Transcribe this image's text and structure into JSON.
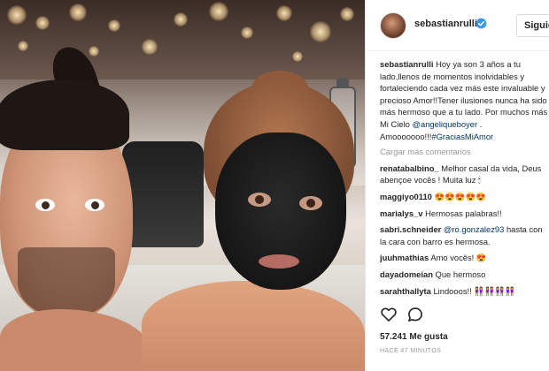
{
  "header": {
    "username": "sebastianrulli",
    "follow_label": "Siguien"
  },
  "post": {
    "caption_user": "sebastianrulli",
    "caption_text_1": "Hoy ya son 3 años a tu lado,llenos de momentos inolvidables y fortaleciendo cada vez más este invaluable y precioso Amor!!Tener ilusiones nunca ha sido más hermoso que a tu lado. Por muchos más Mi Cielo ",
    "caption_mention": "@angeliqueboyer",
    "caption_text_2": " . Amooooooo!!!",
    "caption_hashtag": "#GraciasMiAmor",
    "load_more": "Cargar más comentarios",
    "likes": "57.241 Me gusta",
    "time": "HACE 47 MINUTOS"
  },
  "comments": [
    {
      "user": "renatabalbino_",
      "text": "Melhor casal da vida, Deus abençoe vocês ! Muita luz 🕯"
    },
    {
      "user": "maggiyo0110",
      "text": "😍😍😍😍😍"
    },
    {
      "user": "marialys_v",
      "text": "Hermosas palabras!!"
    },
    {
      "user": "sabri.schneider",
      "mention": "@ro.gonzalez93",
      "text": " hasta con la cara con barro es hermosa."
    },
    {
      "user": "juuhmathias",
      "text": "Amo vocês! 😍"
    },
    {
      "user": "dayadomeian",
      "text": "Que hermoso"
    },
    {
      "user": "sarahthallyta",
      "text": "Lindooos!! 👭👭👭👭"
    }
  ],
  "colors": {
    "verified_blue": "#3897f0",
    "link_blue": "#003569",
    "muted": "#999999"
  },
  "icons": {
    "verified": "verified-badge-icon",
    "like": "heart-icon",
    "comment": "comment-icon"
  }
}
